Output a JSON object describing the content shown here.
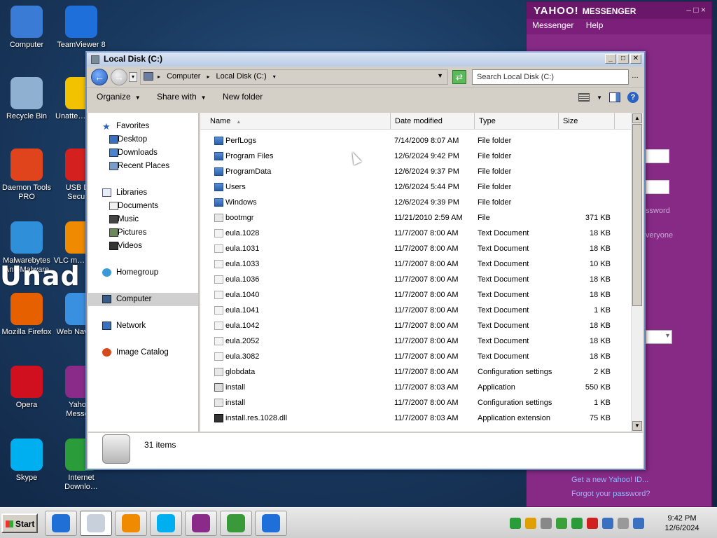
{
  "desktop": {
    "icons": [
      {
        "label": "Computer",
        "icon": "monitor-icon",
        "color": "#3a7bd5"
      },
      {
        "label": "TeamViewer 8",
        "icon": "teamviewer-icon",
        "color": "#1e6fd9"
      },
      {
        "label": "Recycle Bin",
        "icon": "recycle-bin-icon",
        "color": "#8fb0d0"
      },
      {
        "label": "Unatte… Sof…",
        "icon": "star-icon",
        "color": "#f2c200"
      },
      {
        "label": "Daemon Tools PRO",
        "icon": "daemon-tools-icon",
        "color": "#e0441c"
      },
      {
        "label": "USB D… Secur…",
        "icon": "usb-shield-icon",
        "color": "#d52020"
      },
      {
        "label": "Malwarebytes Anti-Malware",
        "icon": "malwarebytes-icon",
        "color": "#2f8fd8"
      },
      {
        "label": "VLC m… play…",
        "icon": "vlc-icon",
        "color": "#f08a00"
      },
      {
        "label": "Mozilla Firefox",
        "icon": "firefox-icon",
        "color": "#e66000"
      },
      {
        "label": "Web Naviga…",
        "icon": "globe-icon",
        "color": "#3a90e0"
      },
      {
        "label": "Opera",
        "icon": "opera-icon",
        "color": "#d0101e"
      },
      {
        "label": "Yaho… Messe…",
        "icon": "yahoo-messenger-icon",
        "color": "#8a2b8a"
      },
      {
        "label": "Skype",
        "icon": "skype-icon",
        "color": "#00aff0"
      },
      {
        "label": "Internet Downlo…",
        "icon": "internet-download-icon",
        "color": "#2a9d3a"
      }
    ],
    "watermark": "Unad i"
  },
  "yahoo": {
    "brand": "YAHOO!",
    "product": "MESSENGER",
    "controls": "– □ ×",
    "menu": [
      "Messenger",
      "Help"
    ],
    "password_hint": "ssword",
    "everyone_hint": "veryone",
    "links": [
      "Get a new Yahoo! ID...",
      "Forgot your password?"
    ]
  },
  "explorer": {
    "title": "Local Disk (C:)",
    "breadcrumbs": [
      "Computer",
      "Local Disk (C:)"
    ],
    "search_placeholder": "Search Local Disk (C:)",
    "toolbar": {
      "organize": "Organize",
      "share": "Share with",
      "new_folder": "New folder"
    },
    "nav": {
      "favorites": "Favorites",
      "favorites_items": [
        "Desktop",
        "Downloads",
        "Recent Places"
      ],
      "libraries": "Libraries",
      "libraries_items": [
        "Documents",
        "Music",
        "Pictures",
        "Videos"
      ],
      "homegroup": "Homegroup",
      "computer": "Computer",
      "network": "Network",
      "image_catalog": "Image Catalog"
    },
    "columns": [
      "Name",
      "Date modified",
      "Type",
      "Size"
    ],
    "files": [
      {
        "name": "PerfLogs",
        "date": "7/14/2009 8:07 AM",
        "type": "File folder",
        "size": "",
        "kind": "folder"
      },
      {
        "name": "Program Files",
        "date": "12/6/2024 9:42 PM",
        "type": "File folder",
        "size": "",
        "kind": "folder"
      },
      {
        "name": "ProgramData",
        "date": "12/6/2024 9:37 PM",
        "type": "File folder",
        "size": "",
        "kind": "folder"
      },
      {
        "name": "Users",
        "date": "12/6/2024 5:44 PM",
        "type": "File folder",
        "size": "",
        "kind": "folder"
      },
      {
        "name": "Windows",
        "date": "12/6/2024 9:39 PM",
        "type": "File folder",
        "size": "",
        "kind": "folder"
      },
      {
        "name": "bootmgr",
        "date": "11/21/2010 2:59 AM",
        "type": "File",
        "size": "371 KB",
        "kind": "file"
      },
      {
        "name": "eula.1028",
        "date": "11/7/2007 8:00 AM",
        "type": "Text Document",
        "size": "18 KB",
        "kind": "text"
      },
      {
        "name": "eula.1031",
        "date": "11/7/2007 8:00 AM",
        "type": "Text Document",
        "size": "18 KB",
        "kind": "text"
      },
      {
        "name": "eula.1033",
        "date": "11/7/2007 8:00 AM",
        "type": "Text Document",
        "size": "10 KB",
        "kind": "text"
      },
      {
        "name": "eula.1036",
        "date": "11/7/2007 8:00 AM",
        "type": "Text Document",
        "size": "18 KB",
        "kind": "text"
      },
      {
        "name": "eula.1040",
        "date": "11/7/2007 8:00 AM",
        "type": "Text Document",
        "size": "18 KB",
        "kind": "text"
      },
      {
        "name": "eula.1041",
        "date": "11/7/2007 8:00 AM",
        "type": "Text Document",
        "size": "1 KB",
        "kind": "text"
      },
      {
        "name": "eula.1042",
        "date": "11/7/2007 8:00 AM",
        "type": "Text Document",
        "size": "18 KB",
        "kind": "text"
      },
      {
        "name": "eula.2052",
        "date": "11/7/2007 8:00 AM",
        "type": "Text Document",
        "size": "18 KB",
        "kind": "text"
      },
      {
        "name": "eula.3082",
        "date": "11/7/2007 8:00 AM",
        "type": "Text Document",
        "size": "18 KB",
        "kind": "text"
      },
      {
        "name": "globdata",
        "date": "11/7/2007 8:00 AM",
        "type": "Configuration settings",
        "size": "2 KB",
        "kind": "file"
      },
      {
        "name": "install",
        "date": "11/7/2007 8:03 AM",
        "type": "Application",
        "size": "550 KB",
        "kind": "app"
      },
      {
        "name": "install",
        "date": "11/7/2007 8:00 AM",
        "type": "Configuration settings",
        "size": "1 KB",
        "kind": "file"
      },
      {
        "name": "install.res.1028.dll",
        "date": "11/7/2007 8:03 AM",
        "type": "Application extension",
        "size": "75 KB",
        "kind": "dll"
      }
    ],
    "status_count": "31 items"
  },
  "taskbar": {
    "start": "Start",
    "apps": [
      {
        "icon": "internet-explorer-icon",
        "color": "#1f6fd6"
      },
      {
        "icon": "explorer-drive-icon",
        "color": "#c8d0dc"
      },
      {
        "icon": "media-player-icon",
        "color": "#f08a00"
      },
      {
        "icon": "skype-icon",
        "color": "#00aff0"
      },
      {
        "icon": "yahoo-messenger-icon",
        "color": "#8a2b8a"
      },
      {
        "icon": "winrar-icon",
        "color": "#3a9a3a"
      },
      {
        "icon": "teamviewer-icon",
        "color": "#1e6fd9"
      }
    ],
    "tray_colors": [
      "#2a9d3a",
      "#e0a000",
      "#888888",
      "#3aa03a",
      "#2a9d3a",
      "#d02020",
      "#3a70c0",
      "#999999",
      "#3a70c0"
    ],
    "time": "9:42 PM",
    "date": "12/6/2024"
  }
}
